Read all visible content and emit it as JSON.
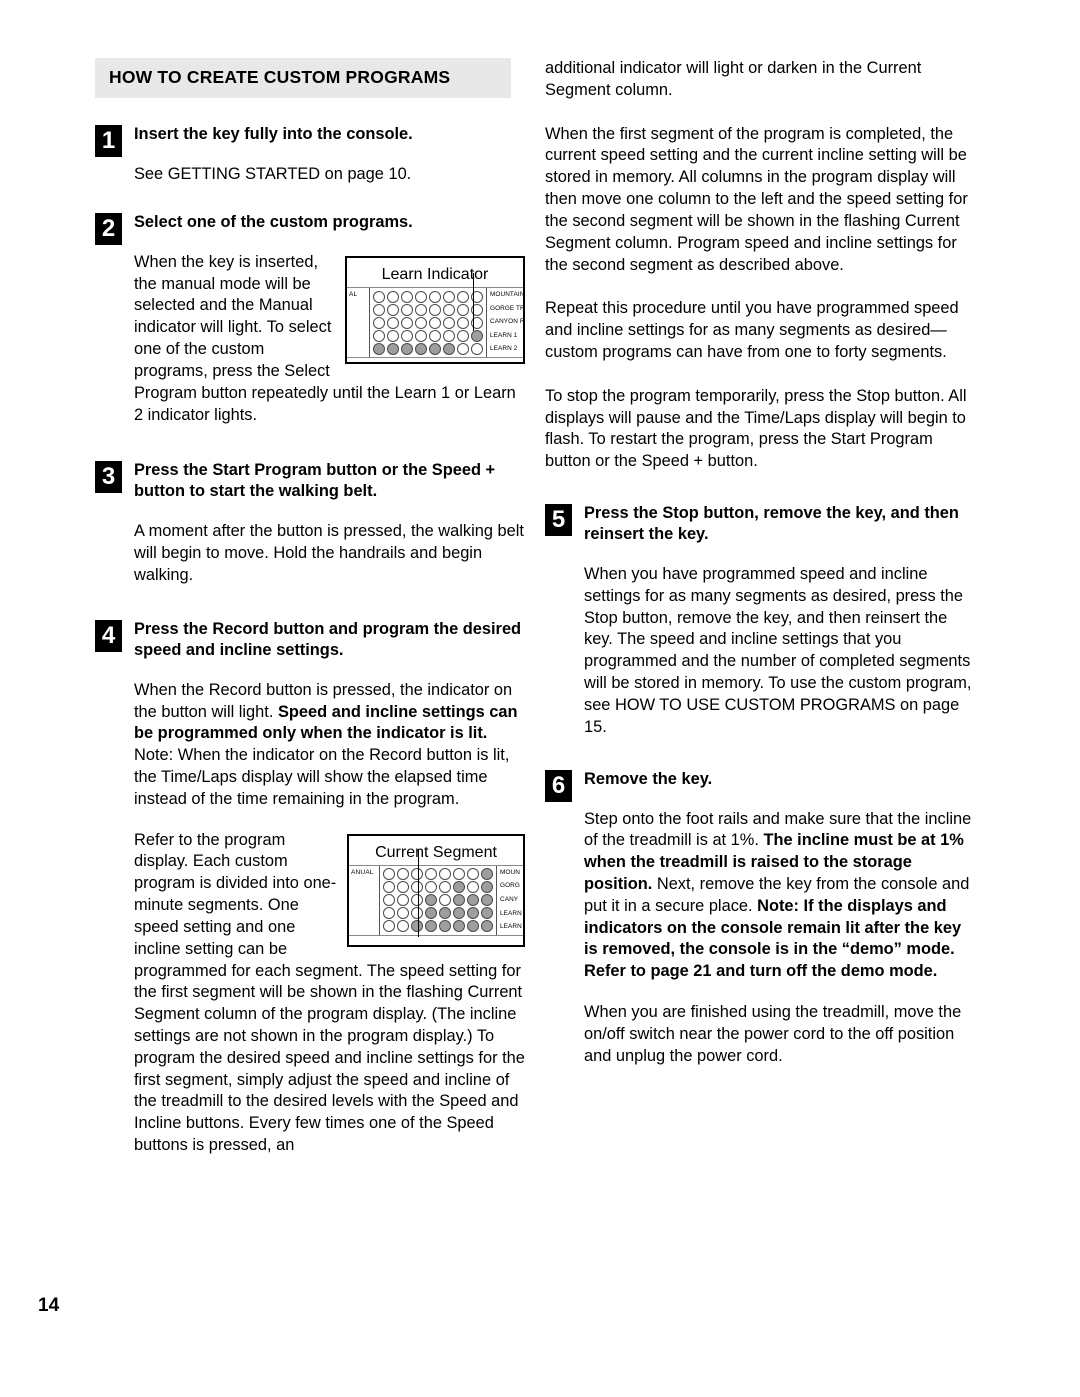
{
  "page": {
    "number": "14"
  },
  "section": {
    "title": "HOW TO CREATE CUSTOM PROGRAMS"
  },
  "left_column": {
    "step1": {
      "number": "1",
      "heading": "Insert the key fully into the console.",
      "body": "See GETTING STARTED on page 10."
    },
    "step2": {
      "number": "2",
      "heading": "Select one of the custom programs.",
      "body": "When the key is inserted, the manual mode will be selected and the Manual indicator will light. To select one of the custom programs, press the Select Program button repeatedly until the Learn 1 or Learn 2 indicator lights."
    },
    "step3": {
      "number": "3",
      "heading": "Press the Start Program button or the Speed + button to start the walking belt.",
      "body": "A moment after the button is pressed, the walking belt will begin to move. Hold the handrails and begin walking."
    },
    "step4": {
      "number": "4",
      "heading": "Press the Record button and program the desired speed and incline settings.",
      "body_part1": "When the Record button is pressed, the indicator on the button will light. ",
      "body_bold1": "Speed and incline settings can be programmed only when the indicator is lit.",
      "body_part2": " Note: When the indicator on the Record button is lit, the Time/Laps display will show the elapsed time instead of the time remaining in the program.",
      "body2": "Refer to the program display. Each custom program is divided into one-minute segments. One speed setting and one incline setting can be programmed for each segment. The speed setting for the first segment will be shown in the flashing Current Segment column of the program display. (The incline settings are not shown in the program display.) To program the desired speed and incline settings for the first segment, simply adjust the speed and incline of the treadmill to the desired levels with the Speed and Incline buttons. Every few times one of the Speed buttons is pressed, an"
    }
  },
  "right_column": {
    "para1": "additional indicator will light or darken in the Current Segment column.",
    "para2": "When the first segment of the program is completed, the current speed setting and the current incline setting will be stored in memory. All columns in the program display will then move one column to the left and the speed setting for the second segment will be shown in the flashing Current Segment column. Program speed and incline settings for the second segment as described above.",
    "para3": "Repeat this procedure until you have programmed speed and incline settings for as many segments as desired—custom programs can have from one to forty segments.",
    "para4": "To stop the program temporarily, press the Stop button. All displays will pause and the Time/Laps display will begin to flash. To restart the program, press the Start Program button or the Speed + button.",
    "step5": {
      "number": "5",
      "heading": "Press the Stop button, remove the key, and then reinsert the key.",
      "body": "When you have programmed speed and incline settings for as many segments as desired, press the Stop button, remove the key, and then reinsert the key. The speed and incline settings that you programmed and the number of completed segments will be stored in memory. To use the custom program, see HOW TO USE CUSTOM PROGRAMS on page 15."
    },
    "step6": {
      "number": "6",
      "heading": "Remove the key.",
      "body_part1": "Step onto the foot rails and make sure that the incline of the treadmill is at 1%. ",
      "body_bold1": "The incline must be at 1% when the treadmill is raised to the storage position.",
      "body_part2": " Next, remove the key from the console and put it in a secure place. ",
      "body_bold2": "Note: If the displays and indicators on the console remain lit after the key is removed, the console is in the “demo” mode. Refer to page 21 and turn off the demo mode.",
      "body2": "When you are finished using the treadmill, move the on/off switch near the power cord to the off position and unplug the power cord."
    }
  },
  "figures": {
    "learn_indicator": {
      "caption": "Learn Indicator",
      "left_label": "AL",
      "row_labels": [
        "MOUNTAIN",
        "GORGE TRAIL",
        "CANYON RUN",
        "LEARN 1",
        "LEARN 2"
      ],
      "columns": 8,
      "grid": [
        [
          0,
          0,
          0,
          0,
          0,
          0,
          0,
          0
        ],
        [
          0,
          0,
          0,
          0,
          0,
          0,
          0,
          0
        ],
        [
          0,
          0,
          0,
          0,
          0,
          0,
          0,
          0
        ],
        [
          0,
          0,
          0,
          0,
          0,
          0,
          0,
          1
        ],
        [
          1,
          1,
          1,
          1,
          1,
          1,
          0,
          0
        ]
      ]
    },
    "current_segment": {
      "caption": "Current Segment",
      "left_label": "ANUAL",
      "row_labels": [
        "MOUN",
        "GORG",
        "CANY",
        "LEARN",
        "LEARN"
      ],
      "columns": 8,
      "grid": [
        [
          0,
          0,
          0,
          0,
          0,
          0,
          0,
          1
        ],
        [
          0,
          0,
          0,
          0,
          0,
          1,
          0,
          1
        ],
        [
          0,
          0,
          0,
          1,
          0,
          1,
          1,
          1
        ],
        [
          0,
          0,
          0,
          1,
          1,
          1,
          1,
          1
        ],
        [
          0,
          0,
          1,
          1,
          1,
          1,
          1,
          1
        ]
      ]
    }
  }
}
